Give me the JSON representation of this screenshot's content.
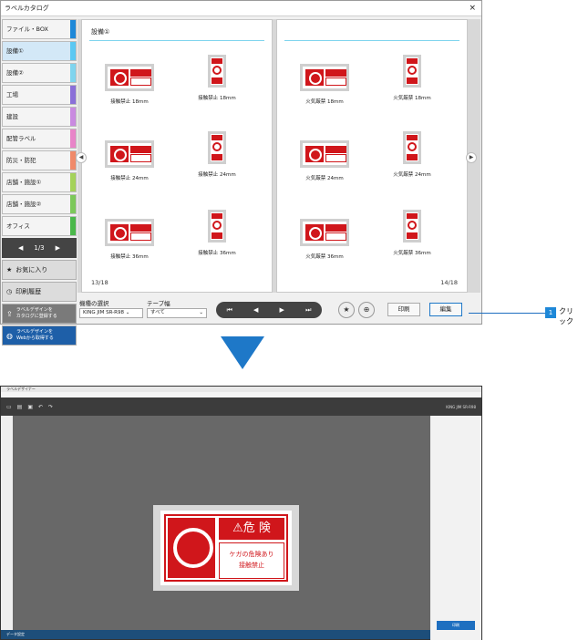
{
  "window": {
    "title": "ラベルカタログ",
    "close": "×"
  },
  "sidebar": {
    "categories": [
      {
        "label": "ファイル・BOX",
        "color": "#1e88d8"
      },
      {
        "label": "設備①",
        "color": "#5bc8f2"
      },
      {
        "label": "設備②",
        "color": "#7fd4ee"
      },
      {
        "label": "工場",
        "color": "#8a6fd8"
      },
      {
        "label": "建設",
        "color": "#c98ae0"
      },
      {
        "label": "配管ラベル",
        "color": "#e884c8"
      },
      {
        "label": "防災・防犯",
        "color": "#f08a6a"
      },
      {
        "label": "店舗・施設①",
        "color": "#a4d25a"
      },
      {
        "label": "店舗・施設②",
        "color": "#7cc85a"
      },
      {
        "label": "オフィス",
        "color": "#4ab84a"
      }
    ],
    "pager": {
      "prev": "◀",
      "text": "1/3",
      "next": "▶"
    },
    "favorites": "お気に入り",
    "history": "印刷履歴",
    "register_line1": "ラベルデザインを",
    "register_line2": "カタログに登録する",
    "web_line1": "ラベルデザインを",
    "web_line2": "Webから取得する"
  },
  "book": {
    "section_title": "設備①",
    "left_page_number": "13/18",
    "right_page_number": "14/18",
    "left_items": [
      "接触禁止 18mm",
      "接触禁止 18mm",
      "接触禁止 24mm",
      "接触禁止 24mm",
      "接触禁止 36mm",
      "接触禁止 36mm"
    ],
    "right_items": [
      "火気厳禁 18mm",
      "火気厳禁 18mm",
      "火気厳禁 24mm",
      "火気厳禁 24mm",
      "火気厳禁 36mm",
      "火気厳禁 36mm"
    ],
    "prev_arrow": "◀",
    "next_arrow": "▶"
  },
  "bottom": {
    "model_label": "機種の選択",
    "model_value": "KING JIM SR-R98",
    "tape_label": "テープ幅",
    "tape_value": "すべて",
    "nav_first": "⏮",
    "nav_prev": "◀",
    "nav_next": "▶",
    "nav_last": "⏭",
    "star": "★",
    "zoom": "⊕",
    "print": "印刷",
    "edit": "編集"
  },
  "callout": {
    "number": "1",
    "text": "クリック"
  },
  "editor": {
    "title": "ラベルデザイナー",
    "device": "KING JIM SR-R98",
    "sign_head": "⚠危 険",
    "sign_line1": "ケガの危険あり",
    "sign_line2": "接触禁止",
    "status": "データ設定",
    "print": "印刷"
  },
  "colors": {
    "danger_red": "#d0161b",
    "accent_blue": "#1e78c8"
  }
}
